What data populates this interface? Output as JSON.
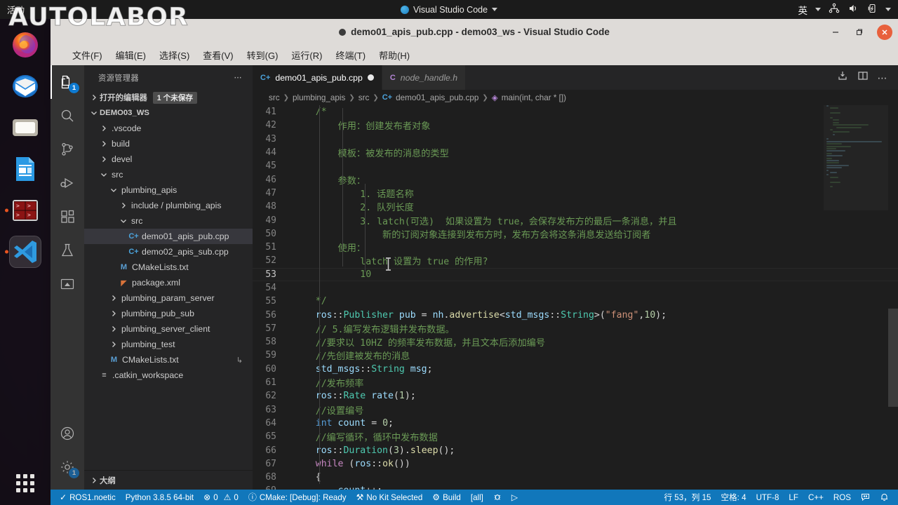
{
  "watermark": "AUTOLABOR",
  "topbar": {
    "activities": "活动",
    "app_name": "Visual Studio Code",
    "ime": "英",
    "icons": [
      "network-icon",
      "volume-icon",
      "battery-icon"
    ]
  },
  "dock": {
    "items": [
      {
        "name": "firefox",
        "label": "Firefox"
      },
      {
        "name": "thunderbird",
        "label": "Thunderbird"
      },
      {
        "name": "files",
        "label": "Files"
      },
      {
        "name": "libreoffice-writer",
        "label": "LibreOffice Writer"
      },
      {
        "name": "terminator",
        "label": "Terminator"
      },
      {
        "name": "vscode",
        "label": "Visual Studio Code"
      }
    ],
    "show_apps": "Show Applications"
  },
  "window": {
    "title": "demo01_apis_pub.cpp - demo03_ws - Visual Studio Code",
    "minimize": "–",
    "maximize": "❐",
    "close": "✕"
  },
  "menu": {
    "items": [
      "文件(F)",
      "编辑(E)",
      "选择(S)",
      "查看(V)",
      "转到(G)",
      "运行(R)",
      "终端(T)",
      "帮助(H)"
    ]
  },
  "activitybar": {
    "items": [
      {
        "name": "explorer",
        "icon": "files-icon",
        "badge": "1",
        "active": true
      },
      {
        "name": "search",
        "icon": "search-icon",
        "badge": "",
        "active": false
      },
      {
        "name": "source-control",
        "icon": "source-control-icon",
        "badge": "",
        "active": false
      },
      {
        "name": "run-and-debug",
        "icon": "run-debug-icon",
        "badge": "",
        "active": false
      },
      {
        "name": "extensions",
        "icon": "extensions-icon",
        "badge": "",
        "active": false
      },
      {
        "name": "testing",
        "icon": "flask-icon",
        "badge": "",
        "active": false
      },
      {
        "name": "remote-explorer",
        "icon": "remote-icon",
        "badge": "",
        "active": false
      }
    ],
    "bottom": [
      {
        "name": "accounts",
        "icon": "account-icon",
        "badge": ""
      },
      {
        "name": "manage",
        "icon": "gear-icon",
        "badge": "1"
      }
    ]
  },
  "sidebar": {
    "title": "资源管理器",
    "more_actions": "⋯",
    "open_editors": {
      "label": "打开的编辑器",
      "badge": "1 个未保存"
    },
    "root": "DEMO03_WS",
    "tree": [
      {
        "label": ".vscode",
        "indent": 1,
        "type": "folder",
        "state": "collapsed"
      },
      {
        "label": "build",
        "indent": 1,
        "type": "folder",
        "state": "collapsed"
      },
      {
        "label": "devel",
        "indent": 1,
        "type": "folder",
        "state": "collapsed"
      },
      {
        "label": "src",
        "indent": 1,
        "type": "folder",
        "state": "expanded"
      },
      {
        "label": "plumbing_apis",
        "indent": 2,
        "type": "folder",
        "state": "expanded"
      },
      {
        "label": "include / plumbing_apis",
        "indent": 3,
        "type": "folder",
        "state": "collapsed"
      },
      {
        "label": "src",
        "indent": 3,
        "type": "folder",
        "state": "expanded"
      },
      {
        "label": "demo01_apis_pub.cpp",
        "indent": 4,
        "type": "cpp",
        "state": "selected"
      },
      {
        "label": "demo02_apis_sub.cpp",
        "indent": 4,
        "type": "cpp",
        "state": "none"
      },
      {
        "label": "CMakeLists.txt",
        "indent": 3,
        "type": "cmake",
        "state": "none"
      },
      {
        "label": "package.xml",
        "indent": 3,
        "type": "xml",
        "state": "none"
      },
      {
        "label": "plumbing_param_server",
        "indent": 2,
        "type": "folder",
        "state": "collapsed"
      },
      {
        "label": "plumbing_pub_sub",
        "indent": 2,
        "type": "folder",
        "state": "collapsed"
      },
      {
        "label": "plumbing_server_client",
        "indent": 2,
        "type": "folder",
        "state": "collapsed"
      },
      {
        "label": "plumbing_test",
        "indent": 2,
        "type": "folder",
        "state": "collapsed"
      },
      {
        "label": "CMakeLists.txt",
        "indent": 2,
        "type": "cmake",
        "state": "symlink"
      },
      {
        "label": ".catkin_workspace",
        "indent": 1,
        "type": "txtlist",
        "state": "none"
      }
    ],
    "outline": "大纲"
  },
  "editor": {
    "tabs": [
      {
        "label": "demo01_apis_pub.cpp",
        "icon": "cpp-icon",
        "active": true,
        "dirty": true,
        "preview": false
      },
      {
        "label": "node_handle.h",
        "icon": "c-icon",
        "active": false,
        "dirty": false,
        "preview": true
      }
    ],
    "tab_actions": [
      "run-icon",
      "split-editor-icon",
      "more-actions-icon"
    ],
    "breadcrumb": [
      "src",
      "plumbing_apis",
      "src",
      "demo01_apis_pub.cpp",
      "main(int, char * [])"
    ],
    "first_line": 41,
    "lines": [
      {
        "n": 41,
        "text": "    /*"
      },
      {
        "n": 42,
        "text": "        作用：创建发布者对象"
      },
      {
        "n": 43,
        "text": ""
      },
      {
        "n": 44,
        "text": "        模板：被发布的消息的类型"
      },
      {
        "n": 45,
        "text": ""
      },
      {
        "n": 46,
        "text": "        参数："
      },
      {
        "n": 47,
        "text": "            1. 话题名称"
      },
      {
        "n": 48,
        "text": "            2. 队列长度"
      },
      {
        "n": 49,
        "text": "            3. latch(可选)  如果设置为 true，会保存发布方的最后一条消息，并且"
      },
      {
        "n": 50,
        "text": "                新的订阅对象连接到发布方时，发布方会将这条消息发送给订阅者"
      },
      {
        "n": 51,
        "text": "        使用："
      },
      {
        "n": 52,
        "text": "            latch 设置为 true 的作用?"
      },
      {
        "n": 53,
        "text": "            10"
      },
      {
        "n": 54,
        "text": ""
      },
      {
        "n": 55,
        "text": "    */"
      },
      {
        "n": 56,
        "text": "    ros::Publisher pub = nh.advertise<std_msgs::String>(\"fang\",10);"
      },
      {
        "n": 57,
        "text": "    // 5.编写发布逻辑并发布数据。"
      },
      {
        "n": 58,
        "text": "    //要求以 10HZ 的频率发布数据，并且文本后添加编号"
      },
      {
        "n": 59,
        "text": "    //先创建被发布的消息"
      },
      {
        "n": 60,
        "text": "    std_msgs::String msg;"
      },
      {
        "n": 61,
        "text": "    //发布频率"
      },
      {
        "n": 62,
        "text": "    ros::Rate rate(1);"
      },
      {
        "n": 63,
        "text": "    //设置编号"
      },
      {
        "n": 64,
        "text": "    int count = 0;"
      },
      {
        "n": 65,
        "text": "    //编写循环，循环中发布数据"
      },
      {
        "n": 66,
        "text": "    ros::Duration(3).sleep();"
      },
      {
        "n": 67,
        "text": "    while (ros::ok())"
      },
      {
        "n": 68,
        "text": "    {"
      },
      {
        "n": 69,
        "text": "        count++;"
      }
    ],
    "current_line": 53
  },
  "statusbar": {
    "left": [
      {
        "name": "ros-distro",
        "icon": "check-icon",
        "label": "ROS1.noetic"
      },
      {
        "name": "python-version",
        "icon": "",
        "label": "Python 3.8.5 64-bit"
      },
      {
        "name": "problems",
        "icon": "error-warning",
        "label": "0  0",
        "errors": "0",
        "warnings": "0"
      },
      {
        "name": "cmake-status",
        "icon": "info-icon",
        "label": "CMake: [Debug]: Ready"
      },
      {
        "name": "cmake-kit",
        "icon": "tools-icon",
        "label": "No Kit Selected"
      },
      {
        "name": "cmake-build",
        "icon": "gear-icon",
        "label": "Build"
      },
      {
        "name": "cmake-target",
        "icon": "",
        "label": "[all]"
      },
      {
        "name": "cmake-debug",
        "icon": "bug-icon",
        "label": ""
      },
      {
        "name": "cmake-launch",
        "icon": "play-icon",
        "label": ""
      }
    ],
    "right": [
      {
        "name": "cursor-position",
        "label": "行 53，列 15"
      },
      {
        "name": "indentation",
        "label": "空格: 4"
      },
      {
        "name": "encoding",
        "label": "UTF-8"
      },
      {
        "name": "eol",
        "label": "LF"
      },
      {
        "name": "language-mode",
        "label": "C++"
      },
      {
        "name": "ros-status",
        "label": "ROS"
      },
      {
        "name": "feedback",
        "label": "",
        "icon": "feedback-icon"
      },
      {
        "name": "notifications",
        "label": "",
        "icon": "bell-icon"
      }
    ]
  },
  "colors": {
    "accent": "#1177bb",
    "editor_bg": "#1e1e1e",
    "sidebar_bg": "#252526",
    "activity_bg": "#333333",
    "titlebar_bg": "#dedbd8",
    "close_btn": "#e8603c",
    "badge": "#0e7ad1"
  }
}
